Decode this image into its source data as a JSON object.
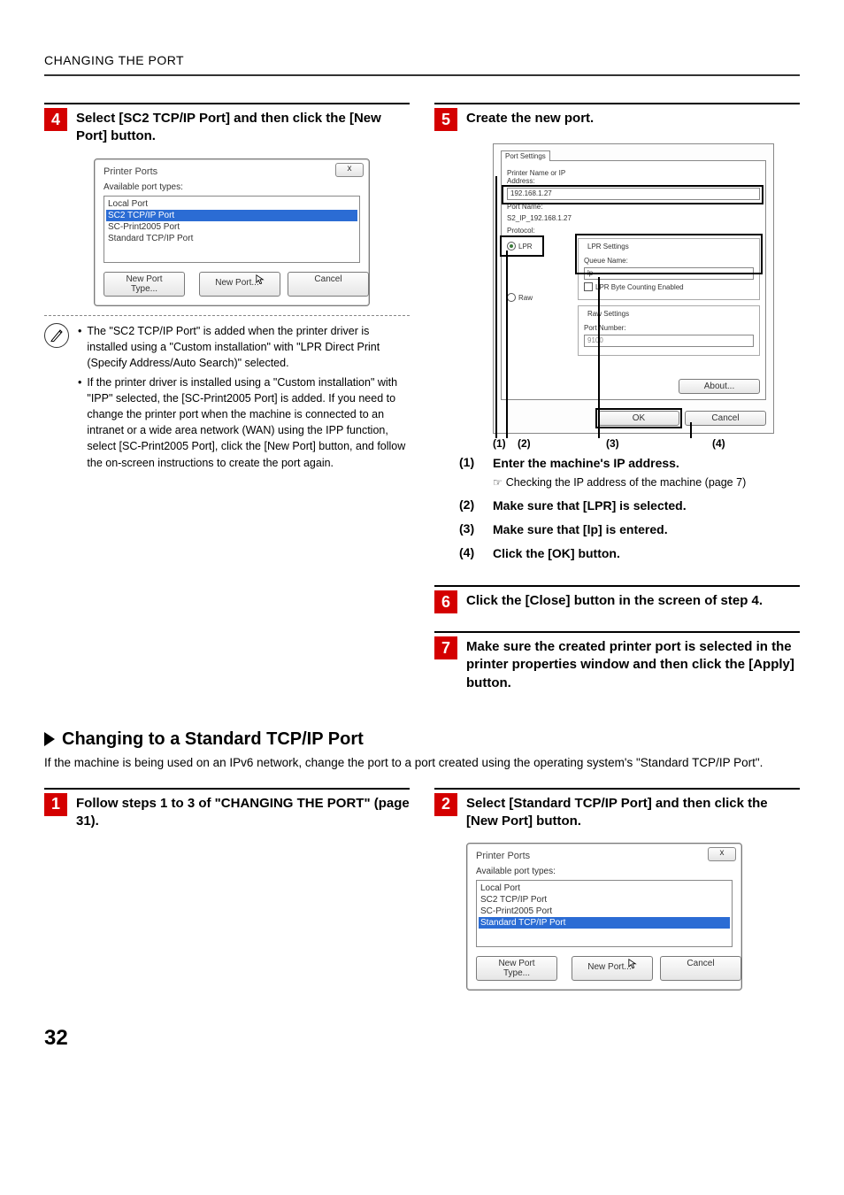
{
  "header": {
    "title": "CHANGING THE PORT"
  },
  "pageNumber": "32",
  "steps": {
    "s4": {
      "num": "4",
      "text": "Select [SC2 TCP/IP Port] and then click the [New Port] button."
    },
    "s5": {
      "num": "5",
      "text": "Create the new port."
    },
    "s6": {
      "num": "6",
      "text": "Click the [Close] button in the screen of step 4."
    },
    "s7": {
      "num": "7",
      "text": "Make sure the created printer port is selected in the printer properties window and then click the [Apply] button."
    },
    "s1b": {
      "num": "1",
      "text": "Follow steps 1 to 3 of \"CHANGING THE PORT\" (page 31)."
    },
    "s2b": {
      "num": "2",
      "text": "Select [Standard TCP/IP Port] and then click the [New Port] button."
    }
  },
  "printerPorts1": {
    "title": "Printer Ports",
    "close": "x",
    "sub": "Available port types:",
    "items": [
      "Local Port",
      "SC2 TCP/IP Port",
      "SC-Print2005 Port",
      "Standard TCP/IP Port"
    ],
    "selectedIndex": 1,
    "btnType": "New Port Type...",
    "btnNew": "New Port...",
    "btnCancel": "Cancel"
  },
  "printerPorts2": {
    "title": "Printer Ports",
    "close": "x",
    "sub": "Available port types:",
    "items": [
      "Local Port",
      "SC2 TCP/IP Port",
      "SC-Print2005 Port",
      "Standard TCP/IP Port"
    ],
    "selectedIndex": 3,
    "btnType": "New Port Type...",
    "btnNew": "New Port...",
    "btnCancel": "Cancel"
  },
  "notes": {
    "n1": "The \"SC2 TCP/IP Port\" is added when the printer driver is installed using a \"Custom installation\" with \"LPR Direct Print (Specify Address/Auto Search)\" selected.",
    "n2": "If the printer driver is installed using a \"Custom installation\" with \"IPP\" selected, the [SC-Print2005 Port] is added. If you need to change the printer port when the machine is connected to an intranet or a wide area network (WAN) using the IPP function, select [SC-Print2005 Port], click the [New Port] button, and follow the on-screen instructions to create the port again."
  },
  "portDialog": {
    "tab": "Port Settings",
    "lblAddr": "Printer Name or IP Address:",
    "valAddr": "192.168.1.27",
    "lblPortName": "Port Name:",
    "valPortName": "S2_IP_192.168.1.27",
    "lblProtocol": "Protocol:",
    "radioLPR": "LPR",
    "radioRaw": "Raw",
    "grpLPR": "LPR Settings",
    "lblQueue": "Queue Name:",
    "valQueue": "lp",
    "chkByte": "LPR Byte Counting Enabled",
    "grpRaw": "Raw Settings",
    "lblPortNum": "Port Number:",
    "valPortNum": "9100",
    "btnAbout": "About...",
    "btnOK": "OK",
    "btnCancel": "Cancel"
  },
  "callouts": {
    "c1": "(1)",
    "c2": "(2)",
    "c3": "(3)",
    "c4": "(4)"
  },
  "subitems": {
    "i1": {
      "num": "(1)",
      "txt": "Enter the machine's IP address.",
      "sub": "Checking the IP address of the machine (page 7)"
    },
    "i2": {
      "num": "(2)",
      "txt": "Make sure that [LPR] is selected."
    },
    "i3": {
      "num": "(3)",
      "txt": "Make sure that [lp] is entered."
    },
    "i4": {
      "num": "(4)",
      "txt": "Click the [OK] button."
    }
  },
  "section2": {
    "heading": "Changing to a Standard TCP/IP Port",
    "para": "If the machine is being used on an IPv6 network, change the port to a port created using the operating system's \"Standard TCP/IP Port\"."
  },
  "bullet": "•",
  "pointer": "☞"
}
